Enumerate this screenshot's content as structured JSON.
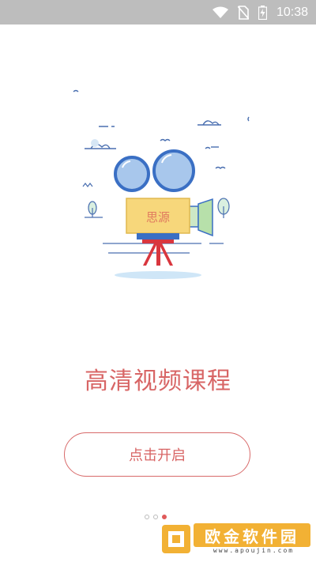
{
  "status_bar": {
    "time": "10:38",
    "icons": [
      "wifi-icon",
      "no-sim-icon",
      "battery-charging-icon"
    ]
  },
  "illustration": {
    "camera_label": "思源"
  },
  "headline": "高清视频课程",
  "start_button": {
    "label": "点击开启"
  },
  "pager": {
    "count": 3,
    "active_index": 2
  },
  "watermark": {
    "text": "欧金软件园",
    "url": "www.apoujin.com"
  },
  "colors": {
    "accent": "#d86565",
    "status_bar": "#bdbdbd",
    "camera_blue": "#3a6fc4",
    "camera_yellow": "#f7d77b",
    "tripod_red": "#d9363e"
  }
}
